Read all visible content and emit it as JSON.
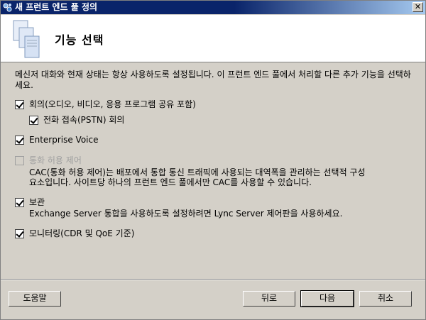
{
  "window": {
    "title": "새 프런트 엔드 풀 정의",
    "close_glyph": "✕"
  },
  "header": {
    "title": "기능 선택"
  },
  "description": "메신저 대화와 현재 상태는 항상 사용하도록 설정됩니다. 이 프런트 엔드 풀에서 처리할 다른 추가 기능을 선택하세요.",
  "features": {
    "conferencing": {
      "label": "회의(오디오, 비디오, 응용 프로그램 공유 포함)",
      "checked": true
    },
    "dialin": {
      "label": "전화 접속(PSTN) 회의",
      "checked": true
    },
    "enterprise_voice": {
      "label": "Enterprise Voice",
      "checked": true
    },
    "cac": {
      "label": "통화 허용 제어",
      "checked": false,
      "disabled": true,
      "description_line1": "CAC(통화 허용 제어)는 배포에서 통합 통신 트래픽에 사용되는 대역폭을 관리하는 선택적 구성",
      "description_line2": "요소입니다. 사이트당 하나의 프런트 엔드 풀에서만 CAC를 사용할 수 있습니다."
    },
    "archiving": {
      "label": "보관",
      "checked": true,
      "description": "Exchange Server 통합을 사용하도록 설정하려면 Lync Server 제어판을 사용하세요."
    },
    "monitoring": {
      "label": "모니터링(CDR 및 QoE 기준)",
      "checked": true
    }
  },
  "buttons": {
    "help": "도움말",
    "back": "뒤로",
    "next": "다음",
    "cancel": "취소"
  }
}
